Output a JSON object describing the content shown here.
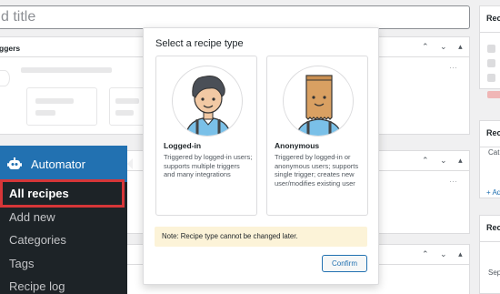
{
  "editor": {
    "title_placeholder": "d title"
  },
  "boxes": {
    "triggers_title": "ggers",
    "controls": "⌃ ⌄ ▴",
    "dots": "···"
  },
  "side": {
    "panel1_title": "Recie",
    "panel2_title": "Reci",
    "panel2_cat": "Cat",
    "panel2_link": "+ Ad",
    "panel3_title": "Reci",
    "panel3_sep": "Sep"
  },
  "menu": {
    "title": "Automator",
    "items": [
      "All recipes",
      "Add new",
      "Categories",
      "Tags",
      "Recipe log"
    ]
  },
  "modal": {
    "title": "Select a recipe type",
    "types": [
      {
        "name": "Logged-in",
        "description": "Triggered by logged-in users; supports multiple triggers and many integrations"
      },
      {
        "name": "Anonymous",
        "description": "Triggered by logged-in or anonymous users; supports single trigger; creates new user/modifies existing user"
      }
    ],
    "note": "Note: Recipe type cannot be changed later.",
    "confirm_label": "Confirm"
  },
  "colors": {
    "accent": "#2271b1",
    "menu_bg": "#1d2327",
    "highlight": "#d63638",
    "note_bg": "#fcf3d8"
  }
}
